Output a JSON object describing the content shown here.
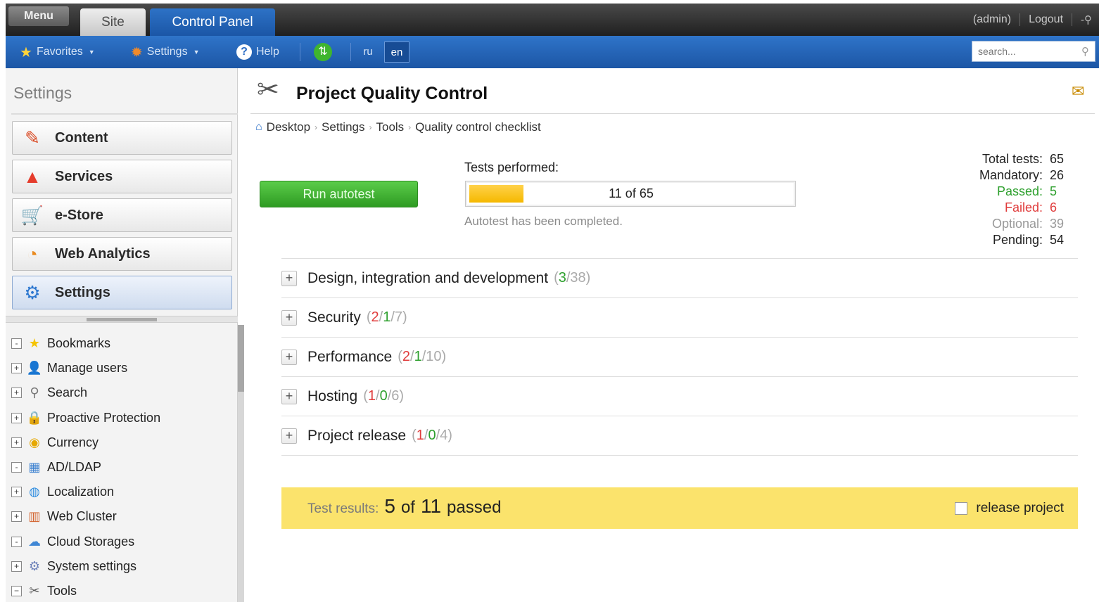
{
  "topbar": {
    "menu": "Menu",
    "tabs": [
      "Site",
      "Control Panel"
    ],
    "user": "(admin)",
    "logout": "Logout"
  },
  "toolbar": {
    "favorites": "Favorites",
    "settings": "Settings",
    "help": "Help",
    "langs": [
      "ru",
      "en"
    ],
    "active_lang": "en",
    "search_placeholder": "search..."
  },
  "sidebar": {
    "title": "Settings",
    "modules": [
      "Content",
      "Services",
      "e-Store",
      "Web Analytics",
      "Settings"
    ],
    "active_module": "Settings",
    "tree": [
      {
        "label": "Bookmarks",
        "expander": "-",
        "icon": "star-icon"
      },
      {
        "label": "Manage users",
        "expander": "+",
        "icon": "users-icon"
      },
      {
        "label": "Search",
        "expander": "+",
        "icon": "magnifier-icon"
      },
      {
        "label": "Proactive Protection",
        "expander": "+",
        "icon": "lock-icon"
      },
      {
        "label": "Currency",
        "expander": "+",
        "icon": "coin-icon"
      },
      {
        "label": "AD/LDAP",
        "expander": "-",
        "icon": "directory-icon"
      },
      {
        "label": "Localization",
        "expander": "+",
        "icon": "globe-icon"
      },
      {
        "label": "Web Cluster",
        "expander": "+",
        "icon": "server-icon"
      },
      {
        "label": "Cloud Storages",
        "expander": "-",
        "icon": "cloud-icon"
      },
      {
        "label": "System settings",
        "expander": "+",
        "icon": "gear-icon"
      },
      {
        "label": "Tools",
        "expander": "−",
        "icon": "tools-icon"
      }
    ]
  },
  "main": {
    "title": "Project Quality Control",
    "breadcrumb": [
      "Desktop",
      "Settings",
      "Tools",
      "Quality control checklist"
    ],
    "run_button": "Run autotest",
    "tests_label": "Tests performed:",
    "progress": {
      "done": 11,
      "total": 65,
      "text": "11 of 65",
      "fraction": 0.169
    },
    "status": "Autotest has been completed.",
    "stats": [
      {
        "label": "Total tests:",
        "value": "65",
        "color": "#222222"
      },
      {
        "label": "Mandatory:",
        "value": "26",
        "color": "#222222"
      },
      {
        "label": "Passed:",
        "value": "5",
        "color": "#2ea02e"
      },
      {
        "label": "Failed:",
        "value": "6",
        "color": "#e03c3c"
      },
      {
        "label": "Optional:",
        "value": "39",
        "color": "#999999"
      },
      {
        "label": "Pending:",
        "value": "54",
        "color": "#222222"
      }
    ],
    "groups": [
      {
        "name": "Design, integration and development",
        "red": "",
        "green": "3",
        "total": "38"
      },
      {
        "name": "Security",
        "red": "2",
        "green": "1",
        "total": "7"
      },
      {
        "name": "Performance",
        "red": "2",
        "green": "1",
        "total": "10"
      },
      {
        "name": "Hosting",
        "red": "1",
        "green": "0",
        "total": "6"
      },
      {
        "name": "Project release",
        "red": "1",
        "green": "0",
        "total": "4"
      }
    ],
    "results": {
      "label": "Test results:",
      "passed": "5",
      "of": "of",
      "total": "11",
      "suffix": "passed",
      "release_label": "release project"
    }
  }
}
